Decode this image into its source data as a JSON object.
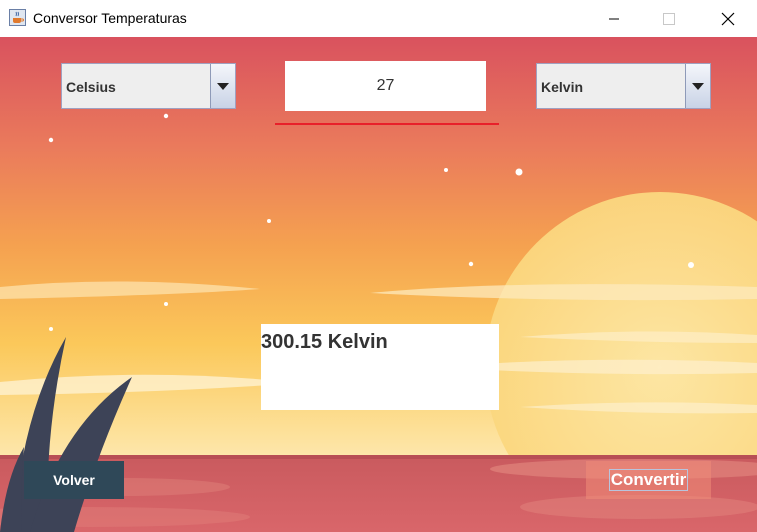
{
  "window": {
    "title": "Conversor Temperaturas"
  },
  "converter": {
    "from_unit": "Celsius",
    "to_unit": "Kelvin",
    "input_value": "27",
    "result": "300.15 Kelvin"
  },
  "buttons": {
    "back_label": "Volver",
    "convert_label": "Convertir"
  },
  "colors": {
    "back_button": "#2f4858",
    "input_underline": "#e8202a"
  },
  "icons": {
    "app": "java-cup-icon",
    "minimize": "minimize-icon",
    "maximize": "maximize-icon",
    "close": "close-icon",
    "dropdown": "dropdown-arrow-icon"
  }
}
